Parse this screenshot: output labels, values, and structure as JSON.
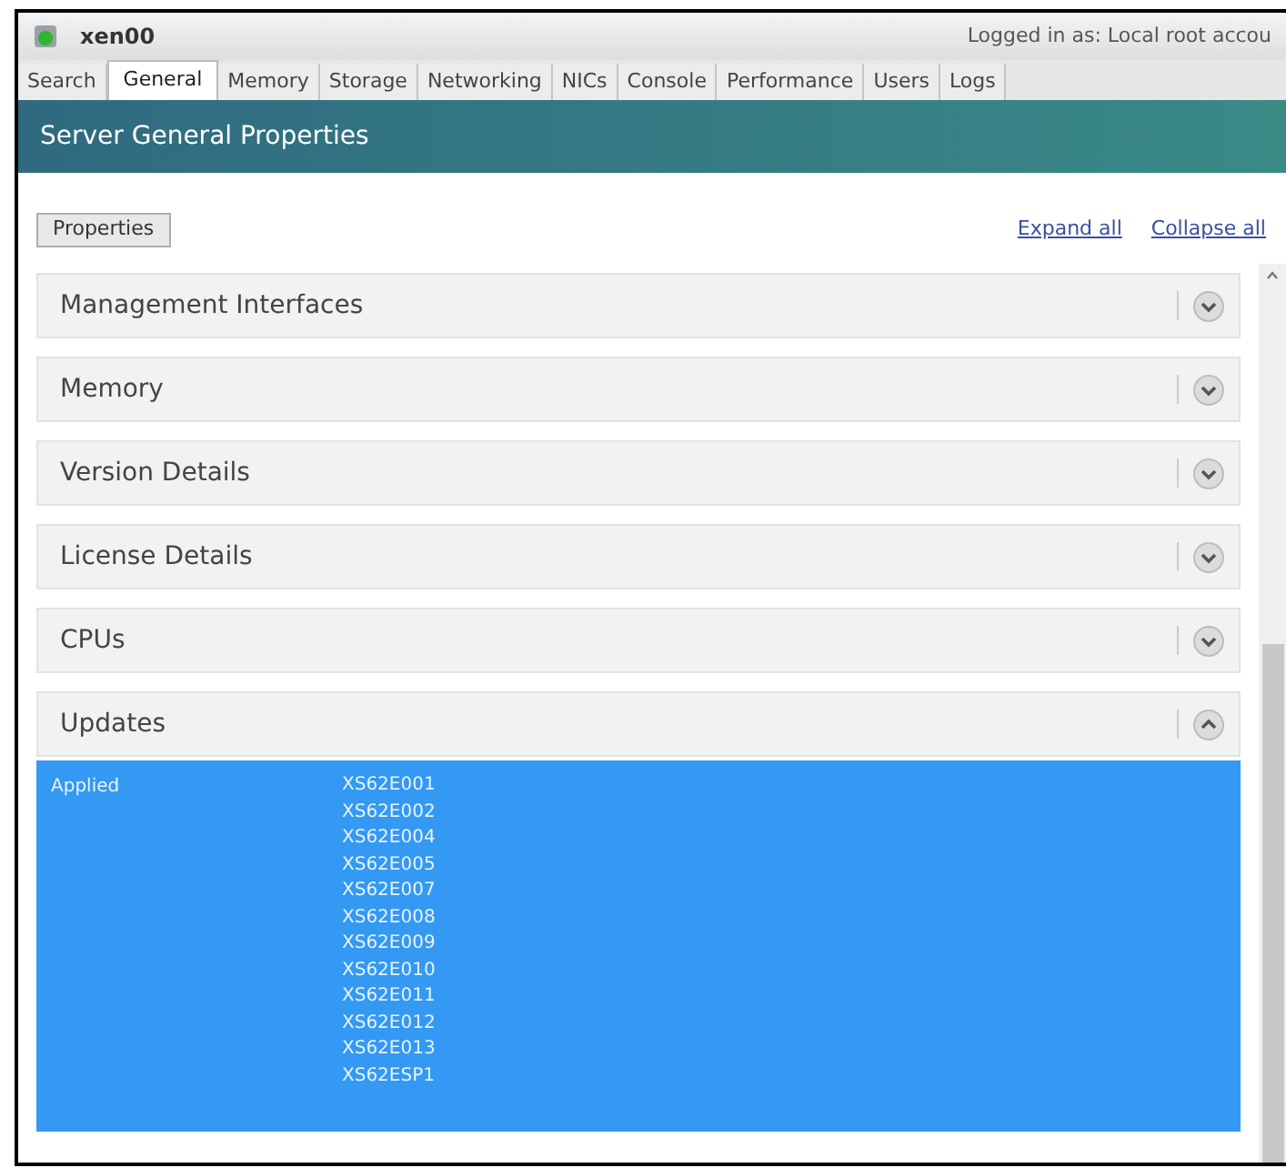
{
  "window": {
    "title": "xen00",
    "login": "Logged in as: Local root accou"
  },
  "tabs": [
    {
      "label": "Search",
      "selected": false
    },
    {
      "label": "General",
      "selected": true
    },
    {
      "label": "Memory",
      "selected": false
    },
    {
      "label": "Storage",
      "selected": false
    },
    {
      "label": "Networking",
      "selected": false
    },
    {
      "label": "NICs",
      "selected": false
    },
    {
      "label": "Console",
      "selected": false
    },
    {
      "label": "Performance",
      "selected": false
    },
    {
      "label": "Users",
      "selected": false
    },
    {
      "label": "Logs",
      "selected": false
    }
  ],
  "banner": "Server General Properties",
  "toolbar": {
    "button": "Properties",
    "links": [
      "Expand all",
      "Collapse all"
    ]
  },
  "sections": [
    {
      "title": "Management Interfaces",
      "expanded": false
    },
    {
      "title": "Memory",
      "expanded": false
    },
    {
      "title": "Version Details",
      "expanded": false
    },
    {
      "title": "License Details",
      "expanded": false
    },
    {
      "title": "CPUs",
      "expanded": false
    },
    {
      "title": "Updates",
      "expanded": true,
      "fields": [
        {
          "label": "Applied",
          "values": [
            "XS62E001",
            "XS62E002",
            "XS62E004",
            "XS62E005",
            "XS62E007",
            "XS62E008",
            "XS62E009",
            "XS62E010",
            "XS62E011",
            "XS62E012",
            "XS62E013",
            "XS62ESP1"
          ]
        }
      ]
    }
  ]
}
